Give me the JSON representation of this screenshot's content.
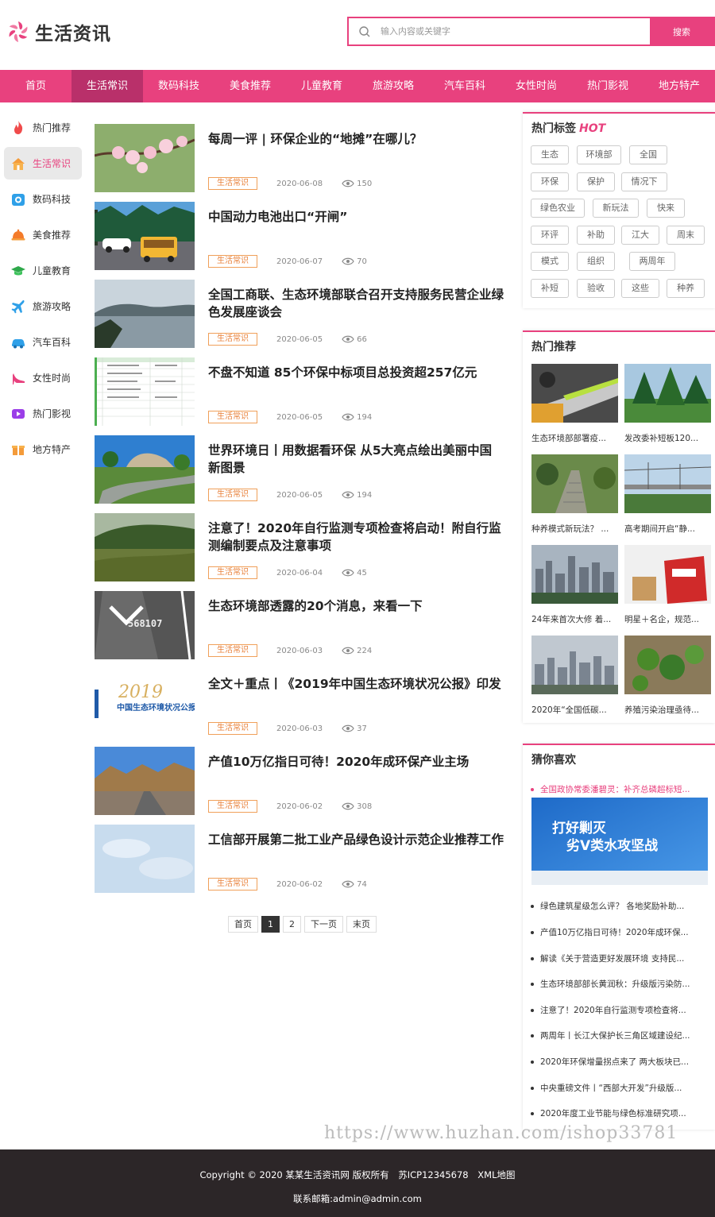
{
  "site": {
    "name": "生活资讯",
    "search_placeholder": "输入内容或关键字",
    "search_button": "搜索",
    "brand_color": "#e8417e"
  },
  "nav": {
    "items": [
      "首页",
      "生活常识",
      "数码科技",
      "美食推荐",
      "儿童教育",
      "旅游攻略",
      "汽车百科",
      "女性时尚",
      "热门影视",
      "地方特产"
    ],
    "active": "生活常识"
  },
  "sidebar": {
    "items": [
      {
        "label": "热门推荐",
        "icon": "flame-icon"
      },
      {
        "label": "生活常识",
        "icon": "house-icon"
      },
      {
        "label": "数码科技",
        "icon": "camera-icon"
      },
      {
        "label": "美食推荐",
        "icon": "food-cover-icon"
      },
      {
        "label": "儿童教育",
        "icon": "graduation-cap-icon"
      },
      {
        "label": "旅游攻略",
        "icon": "airplane-icon"
      },
      {
        "label": "汽车百科",
        "icon": "car-icon"
      },
      {
        "label": "女性时尚",
        "icon": "high-heel-icon"
      },
      {
        "label": "热门影视",
        "icon": "video-play-icon"
      },
      {
        "label": "地方特产",
        "icon": "gift-box-icon"
      }
    ],
    "active": "生活常识"
  },
  "articles": [
    {
      "title": "每周一评 | 环保企业的“地摊”在哪儿？",
      "tag": "生活常识",
      "date": "2020-06-08",
      "views": "150"
    },
    {
      "title": "中国动力电池出口“开闸”",
      "tag": "生活常识",
      "date": "2020-06-07",
      "views": "70"
    },
    {
      "title": "全国工商联、生态环境部联合召开支持服务民营企业绿色发展座谈会",
      "tag": "生活常识",
      "date": "2020-06-05",
      "views": "66"
    },
    {
      "title": "不盘不知道 85个环保中标项目总投资超257亿元",
      "tag": "生活常识",
      "date": "2020-06-05",
      "views": "194"
    },
    {
      "title": "世界环境日丨用数据看环保 从5大亮点绘出美丽中国新图景",
      "tag": "生活常识",
      "date": "2020-06-05",
      "views": "194"
    },
    {
      "title": "注意了！2020年自行监测专项检查将启动！附自行监测编制要点及注意事项",
      "tag": "生活常识",
      "date": "2020-06-04",
      "views": "45"
    },
    {
      "title": "生态环境部透露的20个消息，来看一下",
      "tag": "生活常识",
      "date": "2020-06-03",
      "views": "224"
    },
    {
      "title": "全文＋重点丨《2019年中国生态环境状况公报》印发",
      "tag": "生活常识",
      "date": "2020-06-03",
      "views": "37"
    },
    {
      "title": "产值10万亿指日可待！2020年成环保产业主场",
      "tag": "生活常识",
      "date": "2020-06-02",
      "views": "308"
    },
    {
      "title": "工信部开展第二批工业产品绿色设计示范企业推荐工作",
      "tag": "生活常识",
      "date": "2020-06-02",
      "views": "74"
    }
  ],
  "thumb_texts": {
    "road_number": "568107",
    "report_year": "2019",
    "report_title": "中国生态环境状况公报"
  },
  "pagination": {
    "first": "首页",
    "pages": [
      "1",
      "2"
    ],
    "current": "1",
    "next": "下一页",
    "last": "末页"
  },
  "hot_tags": {
    "title": "热门标签",
    "hot": "HOT",
    "tags": [
      "生态",
      "环境部",
      "全国",
      "环保",
      "保护",
      "情况下",
      "绿色农业",
      "新玩法",
      "快来",
      "环评",
      "补助",
      "江大",
      "周末",
      "模式",
      "组织",
      "两周年",
      "补短",
      "验收",
      "这些",
      "种养"
    ]
  },
  "hot_recommend": {
    "title": "热门推荐",
    "items": [
      "生态环境部部署疫...",
      "发改委补短板120...",
      "种养模式新玩法？ ...",
      "高考期间开启“静...",
      "24年来首次大修 着...",
      "明星＋名企，规范...",
      "2020年“全国低碳...",
      "养殖污染治理亟待..."
    ]
  },
  "guess": {
    "title": "猜你喜欢",
    "first": "全国政协常委潘碧灵：补齐总磷超标短...",
    "banner_line1": "打好剿灭",
    "banner_line2": "劣V类水攻坚战",
    "items": [
      "绿色建筑星级怎么评？ 各地奖励补助...",
      "产值10万亿指日可待！2020年成环保...",
      "解读《关于营造更好发展环境 支持民...",
      "生态环境部部长黄润秋：升级版污染防...",
      "注意了！2020年自行监测专项检查将...",
      "两周年丨长江大保护长三角区域建设纪...",
      "2020年环保增量拐点来了 两大板块已...",
      "中央重磅文件丨“西部大开发”升级版...",
      "2020年度工业节能与绿色标准研究项..."
    ]
  },
  "watermark": "https://www.huzhan.com/ishop33781",
  "footer": {
    "copyright": "Copyright © 2020 某某生活资讯网 版权所有",
    "icp": "苏ICP12345678",
    "sitemap": "XML地图",
    "email": "联系邮箱:admin@admin.com"
  }
}
